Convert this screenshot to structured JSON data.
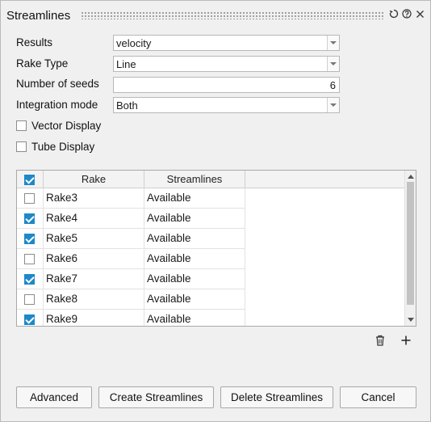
{
  "window": {
    "title": "Streamlines",
    "icons": [
      "reset-icon",
      "help-icon",
      "close-icon"
    ]
  },
  "form": {
    "results_label": "Results",
    "results_value": "velocity",
    "rake_type_label": "Rake Type",
    "rake_type_value": "Line",
    "seeds_label": "Number of seeds",
    "seeds_value": "6",
    "integration_label": "Integration mode",
    "integration_value": "Both",
    "vector_display_label": "Vector Display",
    "vector_display_checked": false,
    "tube_display_label": "Tube Display",
    "tube_display_checked": false
  },
  "table": {
    "columns": [
      "Rake",
      "Streamlines"
    ],
    "header_checkbox_checked": true,
    "rows": [
      {
        "name": "Rake3",
        "status": "Available",
        "checked": false
      },
      {
        "name": "Rake4",
        "status": "Available",
        "checked": true
      },
      {
        "name": "Rake5",
        "status": "Available",
        "checked": true
      },
      {
        "name": "Rake6",
        "status": "Available",
        "checked": false
      },
      {
        "name": "Rake7",
        "status": "Available",
        "checked": true
      },
      {
        "name": "Rake8",
        "status": "Available",
        "checked": false
      },
      {
        "name": "Rake9",
        "status": "Available",
        "checked": true
      }
    ]
  },
  "buttons": {
    "advanced": "Advanced",
    "create": "Create Streamlines",
    "delete": "Delete Streamlines",
    "cancel": "Cancel"
  },
  "colors": {
    "accent": "#1e88c8",
    "panel_bg": "#f0f0f0"
  }
}
